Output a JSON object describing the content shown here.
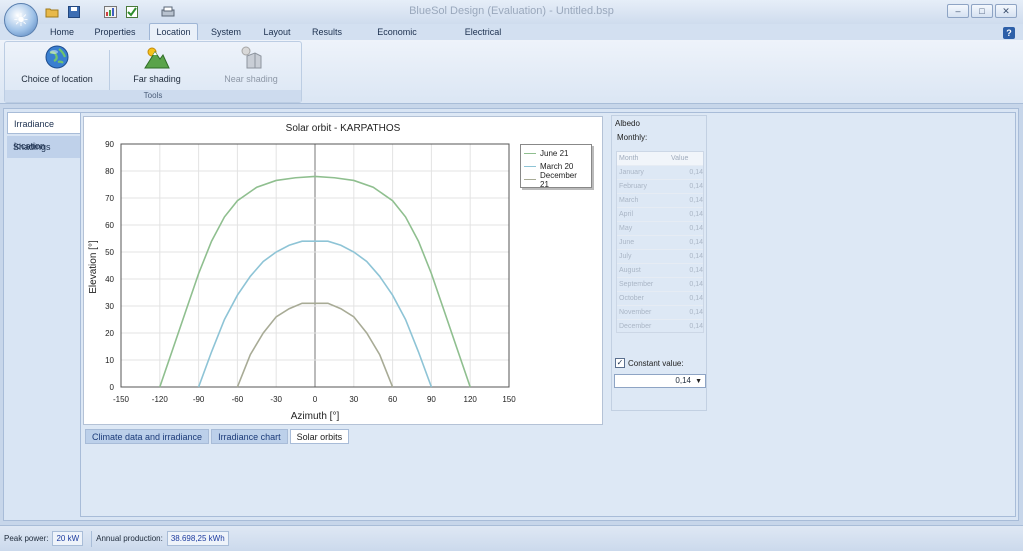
{
  "window": {
    "title": "BlueSol Design (Evaluation) - Untitled.bsp"
  },
  "ribbon_tabs": [
    "Home",
    "Properties",
    "Location",
    "System",
    "Layout",
    "Results",
    "Economic analysis",
    "Electrical scheme"
  ],
  "active_tab": "Location",
  "ribbon": {
    "buttons": [
      {
        "label": "Choice of location",
        "icon": "globe-icon",
        "enabled": true
      },
      {
        "label": "Far shading",
        "icon": "mountain-sun-icon",
        "enabled": true
      },
      {
        "label": "Near shading",
        "icon": "building-sun-icon",
        "enabled": false
      }
    ],
    "group_label": "Tools"
  },
  "side_tabs": [
    {
      "label": "Irradiance location",
      "active": true
    },
    {
      "label": "Shadings",
      "active": false
    }
  ],
  "bottom_tabs": [
    {
      "label": "Climate data and irradiance",
      "active": false
    },
    {
      "label": "Irradiance chart",
      "active": false
    },
    {
      "label": "Solar orbits",
      "active": true
    }
  ],
  "albedo": {
    "title": "Albedo",
    "monthly_label": "Monthly:",
    "header_month": "Month",
    "header_value": "Value",
    "months": [
      {
        "month": "January",
        "value": "0,14"
      },
      {
        "month": "February",
        "value": "0,14"
      },
      {
        "month": "March",
        "value": "0,14"
      },
      {
        "month": "April",
        "value": "0,14"
      },
      {
        "month": "May",
        "value": "0,14"
      },
      {
        "month": "June",
        "value": "0,14"
      },
      {
        "month": "July",
        "value": "0,14"
      },
      {
        "month": "August",
        "value": "0,14"
      },
      {
        "month": "September",
        "value": "0,14"
      },
      {
        "month": "October",
        "value": "0,14"
      },
      {
        "month": "November",
        "value": "0,14"
      },
      {
        "month": "December",
        "value": "0,14"
      }
    ],
    "constant_label": "Constant value:",
    "constant_checked": true,
    "constant_value": "0,14"
  },
  "status": {
    "peak_power_label": "Peak power:",
    "peak_power_value": "20 kW",
    "annual_label": "Annual production:",
    "annual_value": "38.698,25 kWh"
  },
  "chart_data": {
    "type": "line",
    "title": "Solar orbit - KARPATHOS",
    "xlabel": "Azimuth [°]",
    "ylabel": "Elevation [°]",
    "xlim": [
      -150,
      150
    ],
    "ylim": [
      0,
      90
    ],
    "xticks": [
      -150,
      -120,
      -90,
      -60,
      -30,
      0,
      30,
      60,
      90,
      120,
      150
    ],
    "yticks": [
      0,
      10,
      20,
      30,
      40,
      50,
      60,
      70,
      80,
      90
    ],
    "grid": true,
    "legend_position": "top-right",
    "series": [
      {
        "name": "June 21",
        "color": "#8fbf8f",
        "x": [
          -120,
          -110,
          -100,
          -90,
          -80,
          -70,
          -60,
          -45,
          -30,
          -15,
          0,
          15,
          30,
          45,
          60,
          70,
          80,
          90,
          100,
          110,
          120
        ],
        "y": [
          0,
          14,
          28,
          42,
          54,
          63,
          69,
          74,
          76.5,
          77.5,
          78,
          77.5,
          76.5,
          74,
          69,
          63,
          54,
          42,
          28,
          14,
          0
        ]
      },
      {
        "name": "March 20",
        "color": "#8ec4d6",
        "x": [
          -90,
          -80,
          -70,
          -60,
          -50,
          -40,
          -30,
          -20,
          -10,
          0,
          10,
          20,
          30,
          40,
          50,
          60,
          70,
          80,
          90
        ],
        "y": [
          0,
          13,
          25,
          34,
          41,
          46.5,
          50,
          52.5,
          54,
          54,
          54,
          52.5,
          50,
          46.5,
          41,
          34,
          25,
          13,
          0
        ]
      },
      {
        "name": "December 21",
        "color": "#a8ab96",
        "x": [
          -60,
          -55,
          -50,
          -40,
          -30,
          -20,
          -10,
          0,
          10,
          20,
          30,
          40,
          50,
          55,
          60
        ],
        "y": [
          0,
          6,
          12,
          20,
          26,
          29,
          31,
          31,
          31,
          29,
          26,
          20,
          12,
          6,
          0
        ]
      }
    ]
  }
}
